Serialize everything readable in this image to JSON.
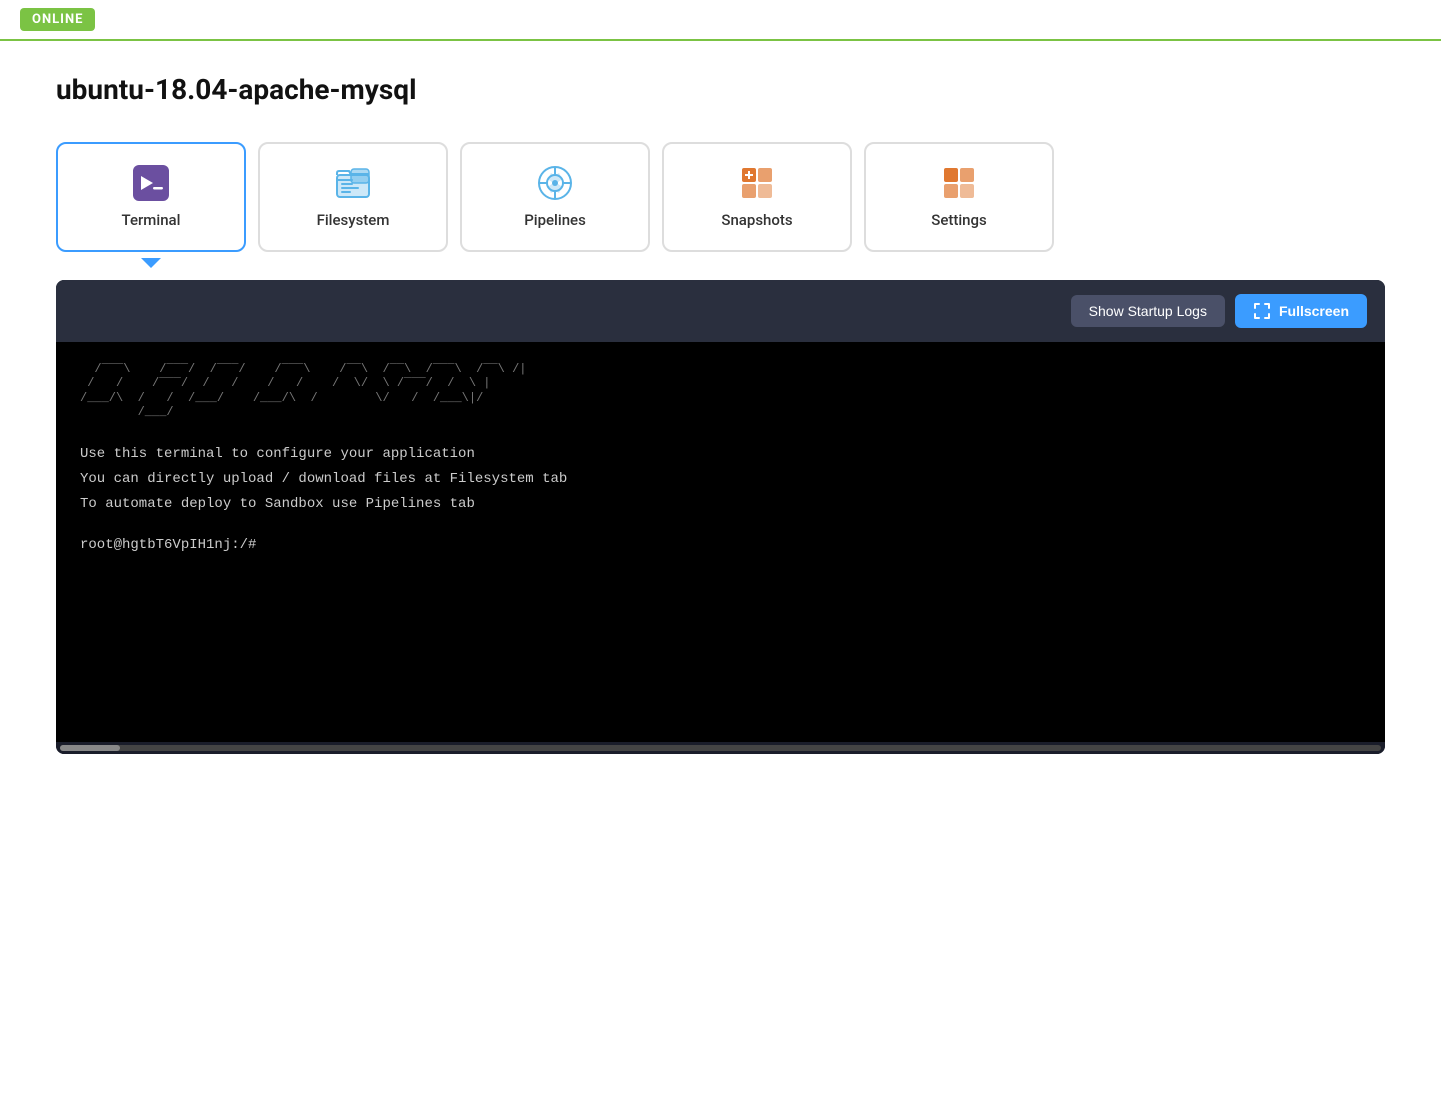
{
  "topbar": {
    "online_label": "ONLINE"
  },
  "page": {
    "title": "ubuntu-18.04-apache-mysql"
  },
  "tabs": [
    {
      "id": "terminal",
      "label": "Terminal",
      "icon": "terminal-icon",
      "active": true
    },
    {
      "id": "filesystem",
      "label": "Filesystem",
      "icon": "filesystem-icon",
      "active": false
    },
    {
      "id": "pipelines",
      "label": "Pipelines",
      "icon": "pipelines-icon",
      "active": false
    },
    {
      "id": "snapshots",
      "label": "Snapshots",
      "icon": "snapshots-icon",
      "active": false
    },
    {
      "id": "settings",
      "label": "Settings",
      "icon": "settings-icon",
      "active": false
    }
  ],
  "terminal": {
    "show_startup_logs_label": "Show Startup Logs",
    "fullscreen_label": "Fullscreen",
    "ascii_art": " /___,    /   /  /   /    /___,    /\\  /\\  /___,  /\\  /|\n/   /    /___/  /   /    /   /    /  \\/  \\ /___/  /  \\ | \n/___/\\  /   /  /___/    /___/\\  /        \\/   /  /___\\|/",
    "line1": "Use this terminal to configure your application",
    "line2": "You can directly upload / download files at Filesystem tab",
    "line3": "To automate deploy to Sandbox use Pipelines tab",
    "prompt": "root@hgtbT6VpIH1nj:/#"
  }
}
